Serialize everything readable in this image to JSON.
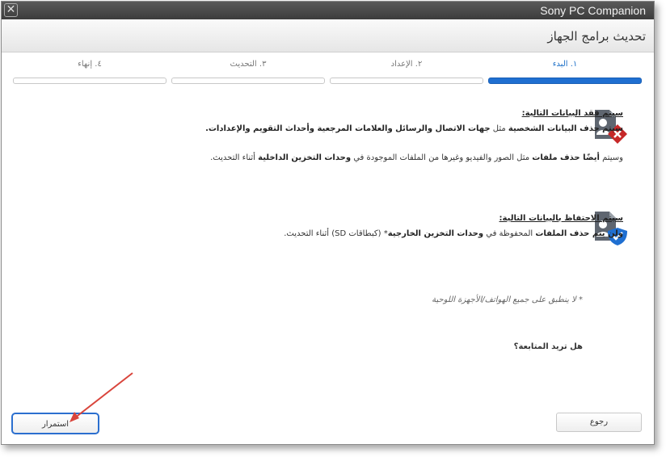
{
  "window": {
    "app_title": "Sony PC Companion"
  },
  "header": {
    "title": "تحديث برامج الجهاز"
  },
  "steps": [
    {
      "label": "١. البدء",
      "active": true
    },
    {
      "label": "٢. الإعداد",
      "active": false
    },
    {
      "label": "٣. التحديث",
      "active": false
    },
    {
      "label": "٤. إنهاء",
      "active": false
    }
  ],
  "loss_section": {
    "title": "سيتم فقد البيانات التالية:",
    "line1_bold": "سيتم حذف البيانات الشخصية",
    "line1_mid": " مثل ",
    "line1_bold2": "جهات الاتصال والرسائل والعلامات المرجعية وأحداث التقويم والإعدادات.",
    "line2_a": "وسيتم ",
    "line2_bold": "أيضًا حذف ملفات",
    "line2_b": " مثل الصور والفيديو وغيرها من الملفات الموجودة في ",
    "line2_bold2": "وحدات التخزين الداخلية",
    "line2_c": " أثناء التحديث."
  },
  "keep_section": {
    "title": "سيتم الاحتفاظ بالبيانات التالية:",
    "line1_bold": "ولن يتم حذف الملفات",
    "line1_mid": " المحفوظة في ",
    "line1_bold2": "وحدات التخزين الخارجية",
    "line1_end": "* (كبطاقات SD) أثناء التحديث."
  },
  "note": "* لا ينطبق على جميع الهواتف/الأجهزة اللوحية",
  "question": "هل تريد المتابعة؟",
  "buttons": {
    "back": "رجوع",
    "continue": "استمرار"
  },
  "colors": {
    "accent": "#1f6fd1",
    "error": "#c62828",
    "titlebar": "#444444"
  },
  "icons": {
    "loss": "user-file-x-icon",
    "keep": "user-file-shield-icon",
    "close": "close-icon"
  }
}
